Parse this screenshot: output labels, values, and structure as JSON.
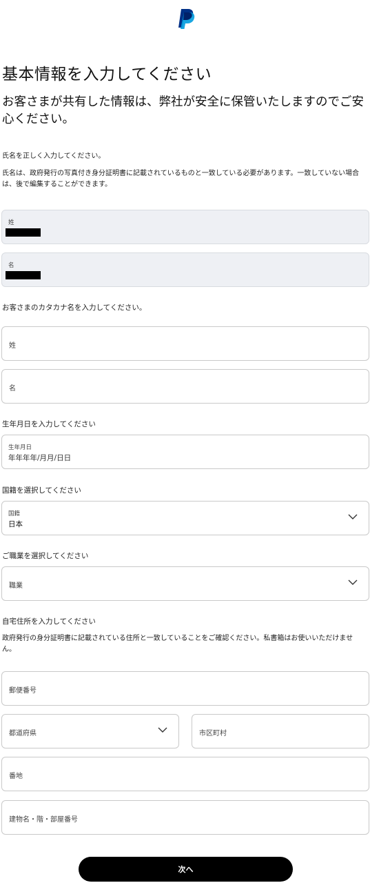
{
  "heading": "基本情報を入力してください",
  "subheading": "お客さまが共有した情報は、弊社が安全に保管いたしますのでご安心ください。",
  "name_section": {
    "instruction": "氏名を正しく入力してください。",
    "note": "氏名は、政府発行の写真付き身分証明書に記載されているものと一致している必要があります。一致していない場合は、後で編集することができます。",
    "last_name_label": "姓",
    "first_name_label": "名"
  },
  "katakana_section": {
    "instruction": "お客さまのカタカナ名を入力してください。",
    "last_name_placeholder": "姓",
    "first_name_placeholder": "名"
  },
  "birthdate_section": {
    "instruction": "生年月日を入力してください",
    "label": "生年月日",
    "placeholder": "年年年年/月月/日日"
  },
  "nationality_section": {
    "instruction": "国籍を選択してください",
    "label": "国籍",
    "value": "日本"
  },
  "occupation_section": {
    "instruction": "ご職業を選択してください",
    "placeholder": "職業"
  },
  "address_section": {
    "instruction": "自宅住所を入力してください",
    "note": "政府発行の身分証明書に記載されている住所と一致していることをご確認ください。私書箱はお使いいただけません。",
    "postal_code_placeholder": "郵便番号",
    "prefecture_placeholder": "都道府県",
    "city_placeholder": "市区町村",
    "street_placeholder": "番地",
    "building_placeholder": "建物名・階・部屋番号"
  },
  "next_button": "次へ",
  "icons": {
    "logo": "paypal-logo",
    "chevron": "chevron-down-icon"
  },
  "colors": {
    "button_bg": "#000000",
    "filled_field_bg": "#eef0f4",
    "logo_dark": "#003087",
    "logo_light": "#009cde"
  }
}
